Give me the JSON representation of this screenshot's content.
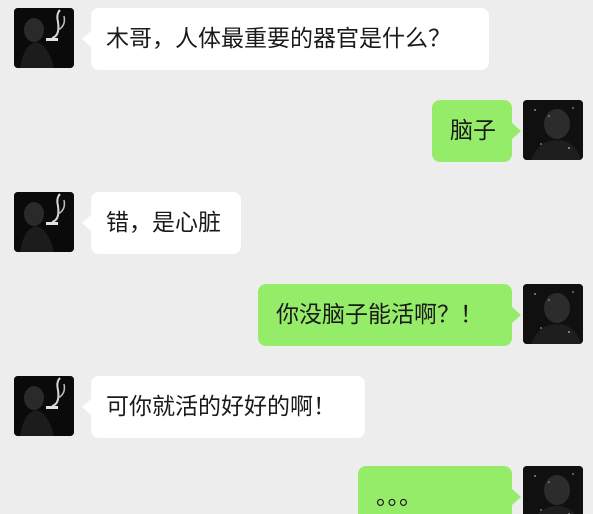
{
  "conversation": {
    "messages": [
      {
        "side": "left",
        "text": "木哥，人体最重要的器官是什么？",
        "avatar_icon": "portrait-smoking-icon"
      },
      {
        "side": "right",
        "text": "脑子",
        "avatar_icon": "dark-portrait-icon"
      },
      {
        "side": "left",
        "text": "错，是心脏",
        "avatar_icon": "portrait-smoking-icon"
      },
      {
        "side": "right",
        "text": "你没脑子能活啊？！",
        "avatar_icon": "dark-portrait-icon"
      },
      {
        "side": "left",
        "text": "可你就活的好好的啊！",
        "avatar_icon": "portrait-smoking-icon"
      },
      {
        "side": "right",
        "text": "。。。",
        "avatar_icon": "dark-portrait-icon"
      }
    ]
  },
  "colors": {
    "background": "#ededed",
    "incoming_bubble": "#ffffff",
    "outgoing_bubble": "#95ec69",
    "text": "#1a1a1a"
  }
}
